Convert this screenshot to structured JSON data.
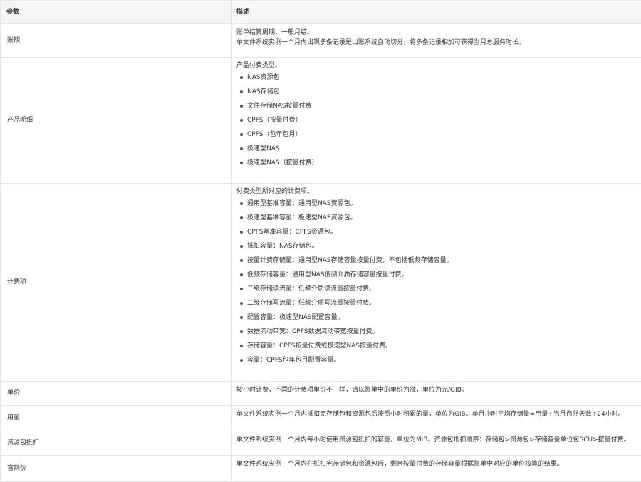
{
  "header": {
    "col_param": "参数",
    "col_desc": "描述"
  },
  "rows": {
    "period": {
      "name": "账期",
      "lines": [
        "账单结算周期，一般月结。",
        "单文件系统实例一个月内出现多条记录是出账系统自动切分，将多条记录相加可获得当月总服务时长。"
      ]
    },
    "product": {
      "name": "产品明细",
      "intro": "产品付费类型。",
      "items": [
        "NAS资源包",
        "NAS存储包",
        "文件存储NAS按量付费",
        "CPFS（按量付费）",
        "CPFS（包年包月）",
        "极速型NAS",
        "极速型NAS（按量付费）"
      ]
    },
    "billing": {
      "name": "计费项",
      "intro": "付费类型所对应的计费项。",
      "items": [
        "通用型基准容量：通用型NAS资源包。",
        "极速型基准容量：极速型NAS资源包。",
        "CPFS基准容量：CPFS资源包。",
        "抵扣容量：NAS存储包。",
        "按量计费存储量：通用型NAS存储容量按量付费，不包括低频存储容量。",
        "低频存储容量：通用型NAS低频介质存储容量按量付费。",
        "二级存储读流量：低频介质读流量按量付费。",
        "二级存储写流量：低频介质写流量按量付费。",
        "配置容量：极速型NAS配置容量。",
        "数据流动带宽：CPFS数据流动带宽按量付费。",
        "存储容量：CPFS按量付费或极速型NAS按量付费。",
        "容量：CPFS包年包月配置容量。"
      ]
    },
    "price": {
      "name": "单价",
      "desc": "按小时计费，不同的计费项单价不一样，请以账单中的单价为准，单位为元/GIB。"
    },
    "usage": {
      "name": "用量",
      "desc": "单文件系统实例一个月内抵扣完存储包和资源包后按照小时积累的量，单位为GiB。单月小时平均存储量=用量÷当月自然天数÷24小时。"
    },
    "resource": {
      "name": "资源包抵扣",
      "desc": "单文件系统实例一个月内每小时使用资源包抵扣的容量，单位为MiB。资源包抵扣顺序：存储包>资源包>存储容量单位包SCU>按量付费。"
    },
    "site_price": {
      "name": "官网价",
      "desc": "单文件系统实例一个月内在抵扣完存储包和资源包后，剩余按量付费的存储容量根据账单中对应的单价核算的结果。"
    }
  }
}
